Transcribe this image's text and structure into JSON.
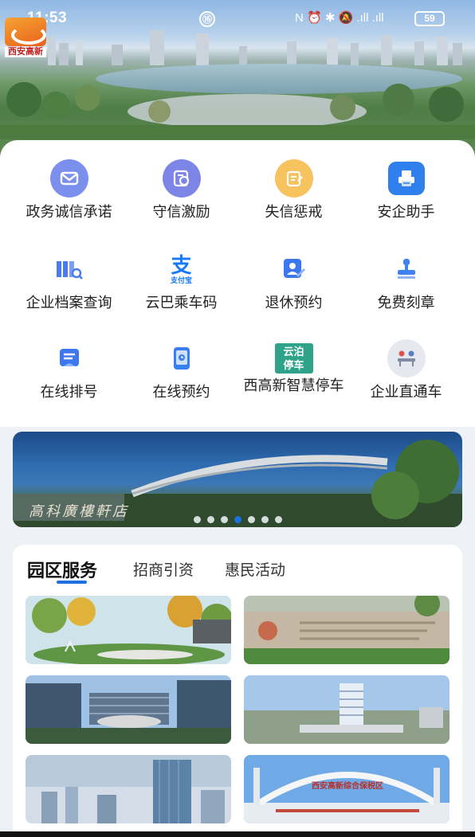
{
  "status_bar": {
    "time": "11:53",
    "center_badge": "⑯",
    "icons": "N ⏰ ✱ 🔕 .ıll .ıll",
    "battery": "59"
  },
  "logo": {
    "text": "西安高新"
  },
  "services": [
    {
      "label": "政务诚信承诺",
      "icon": "envelope-icon",
      "color": "#6f86e8"
    },
    {
      "label": "守信激励",
      "icon": "certificate-icon",
      "color": "#7b84e6"
    },
    {
      "label": "失信惩戒",
      "icon": "document-edit-icon",
      "color": "#f4b84d"
    },
    {
      "label": "安企助手",
      "icon": "printer-icon",
      "color": "#2f80ed"
    },
    {
      "label": "企业档案查询",
      "icon": "archive-search-icon",
      "color": "#4a7bf0"
    },
    {
      "label": "云巴乘车码",
      "icon": "alipay-icon",
      "color": "#1677ff",
      "sublabel": "支付宝"
    },
    {
      "label": "退休预约",
      "icon": "retire-profile-icon",
      "color": "#3b78f0"
    },
    {
      "label": "免费刻章",
      "icon": "stamp-icon",
      "color": "#3e83f2"
    },
    {
      "label": "在线排号",
      "icon": "ticket-icon",
      "color": "#3d78ef"
    },
    {
      "label": "在线预约",
      "icon": "tablet-icon",
      "color": "#3a7ff0"
    },
    {
      "label": "西高新智慧停车",
      "icon": "parking-logo-icon",
      "color": "#2fa38a",
      "badge_lines": [
        "云泊",
        "停车"
      ]
    },
    {
      "label": "企业直通车",
      "icon": "meeting-icon",
      "color": "#7f8aa3"
    }
  ],
  "banner": {
    "sign_text": "高科廣樓軒店",
    "dot_count": 7,
    "active_dot": 3
  },
  "park": {
    "tabs": [
      {
        "label": "园区服务",
        "active": true
      },
      {
        "label": "招商引资",
        "active": false
      },
      {
        "label": "惠民活动",
        "active": false
      }
    ],
    "photos": [
      {
        "name": "park-garden-photo"
      },
      {
        "name": "stone-wall-photo"
      },
      {
        "name": "glass-campus-photo"
      },
      {
        "name": "tower-aerial-photo"
      },
      {
        "name": "skyscraper-photo"
      },
      {
        "name": "arch-bridge-photo",
        "caption": "西安高新综合保税区"
      }
    ]
  }
}
